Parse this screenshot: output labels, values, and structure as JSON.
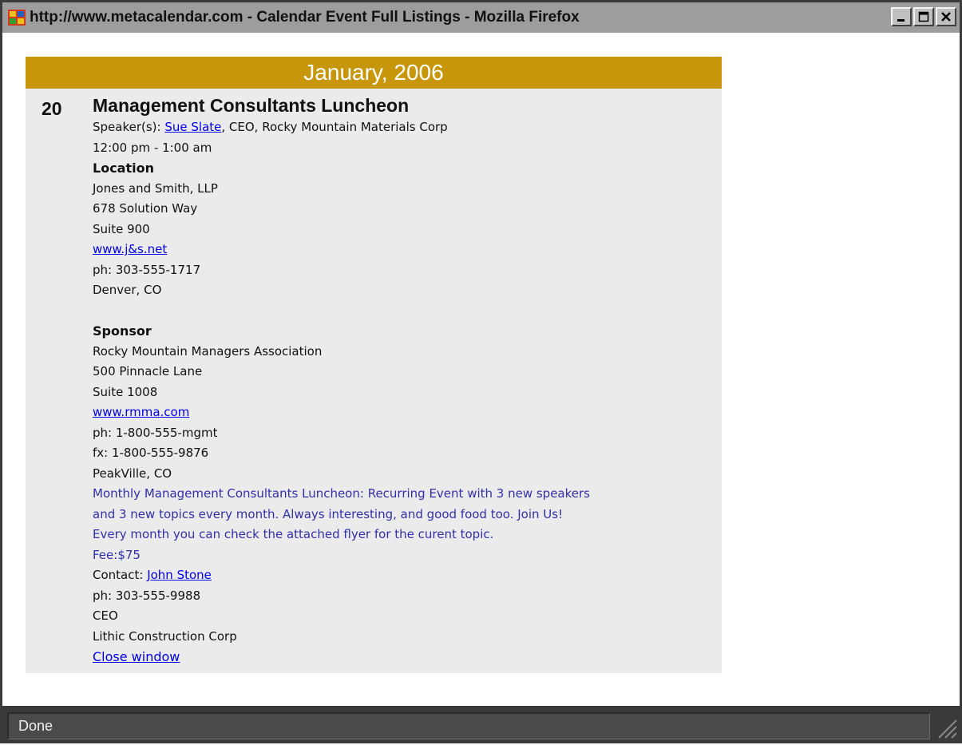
{
  "window": {
    "title": "http://www.metacalendar.com - Calendar Event Full Listings - Mozilla Firefox",
    "buttons": [
      "minimize",
      "maximize",
      "close"
    ]
  },
  "calendar": {
    "month_header": "January, 2006",
    "day": "20",
    "event": {
      "title": "Management Consultants Luncheon",
      "speaker_prefix": "Speaker(s):",
      "speaker_name": "Sue Slate",
      "speaker_suffix": ", CEO, Rocky Mountain Materials Corp",
      "time": "12:00 pm - 1:00 am",
      "location": {
        "heading": "Location",
        "name": "Jones and Smith, LLP",
        "address1": "678 Solution Way",
        "address2": "Suite 900",
        "website": "www.j&s.net",
        "phone": "ph: 303-555-1717",
        "city": "Denver, CO"
      },
      "sponsor": {
        "heading": "Sponsor",
        "name": "Rocky Mountain Managers Association",
        "address1": "500 Pinnacle Lane",
        "address2": "Suite 1008",
        "website": "www.rmma.com",
        "phone": "ph: 1-800-555-mgmt",
        "fax": "fx: 1-800-555-9876",
        "city": "PeakVille, CO"
      },
      "description": [
        "Monthly Management Consultants Luncheon: Recurring Event with 3 new speakers",
        "and 3 new topics every month. Always interesting, and good food too. Join Us!",
        "Every month you can check the attached flyer for the curent topic."
      ],
      "fee": "Fee:$75",
      "contact": {
        "prefix": "Contact:",
        "name": "John Stone",
        "phone": "ph: 303-555-9988",
        "role": "CEO",
        "company": "Lithic Construction Corp"
      },
      "close_link": "Close window"
    }
  },
  "status_bar": {
    "text": "Done"
  },
  "colors": {
    "month_header_bg": "#c8960b",
    "event_bg": "#ebebeb",
    "link": "#0000ee",
    "description_text": "#3030a8",
    "titlebar_bg": "#9d9d9d"
  }
}
